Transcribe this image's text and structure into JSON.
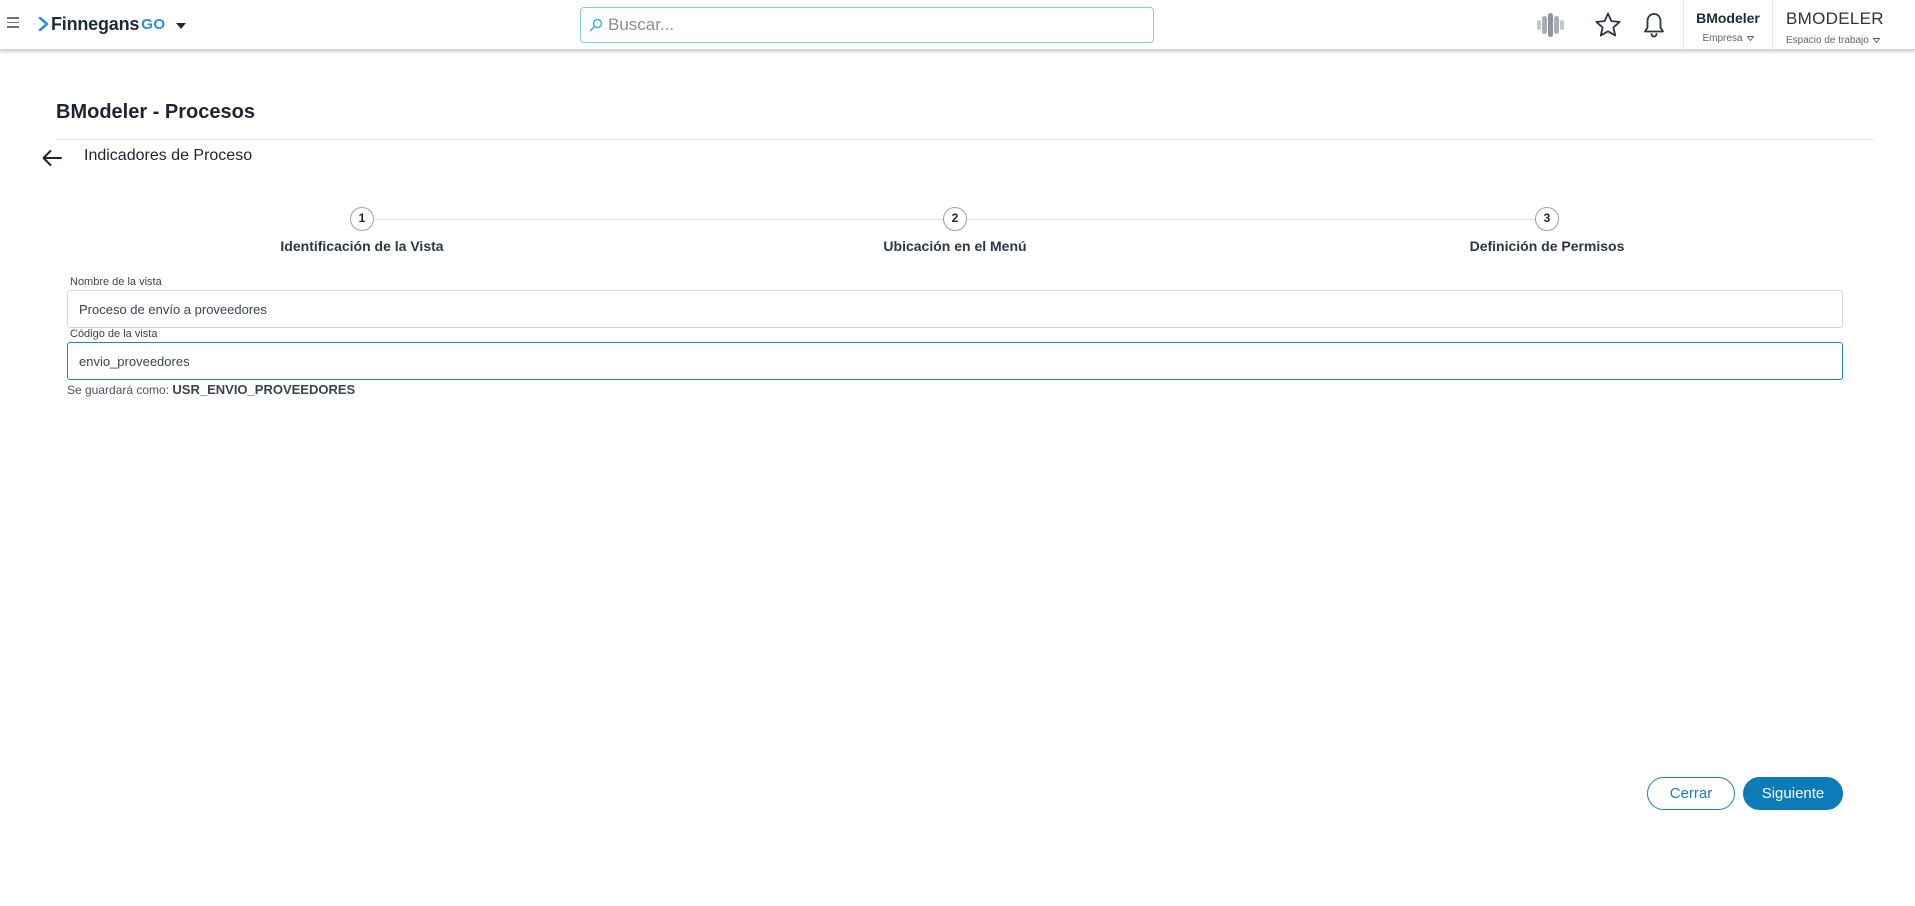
{
  "header": {
    "logo_text": "Finnegans",
    "logo_suffix": "GO",
    "search_placeholder": "Buscar...",
    "company_name": "BModeler",
    "company_label": "Empresa",
    "workspace_name": "BMODELER",
    "workspace_label": "Espacio de trabajo",
    "icons": [
      "menu-icon",
      "search-icon",
      "ai-assistant-icon",
      "star-icon",
      "bell-icon"
    ]
  },
  "page": {
    "title": "BModeler - Procesos",
    "subtitle": "Indicadores de Proceso"
  },
  "stepper": {
    "steps": [
      {
        "number": "1",
        "label": "Identificación de la Vista"
      },
      {
        "number": "2",
        "label": "Ubicación en el Menú"
      },
      {
        "number": "3",
        "label": "Definición de Permisos"
      }
    ]
  },
  "form": {
    "name_label": "Nombre de la vista",
    "name_value": "Proceso de envío a proveedores",
    "code_label": "Código de la vista",
    "code_value": "envio_proveedores",
    "hint_prefix": "Se guardará como:",
    "hint_value": "USR_ENVIO_PROVEEDORES"
  },
  "actions": {
    "close_label": "Cerrar",
    "next_label": "Siguiente"
  },
  "colors": {
    "accent": "#0d7bb8",
    "search_border": "#7fd0e6",
    "logo_go": "#2f8fd6"
  }
}
